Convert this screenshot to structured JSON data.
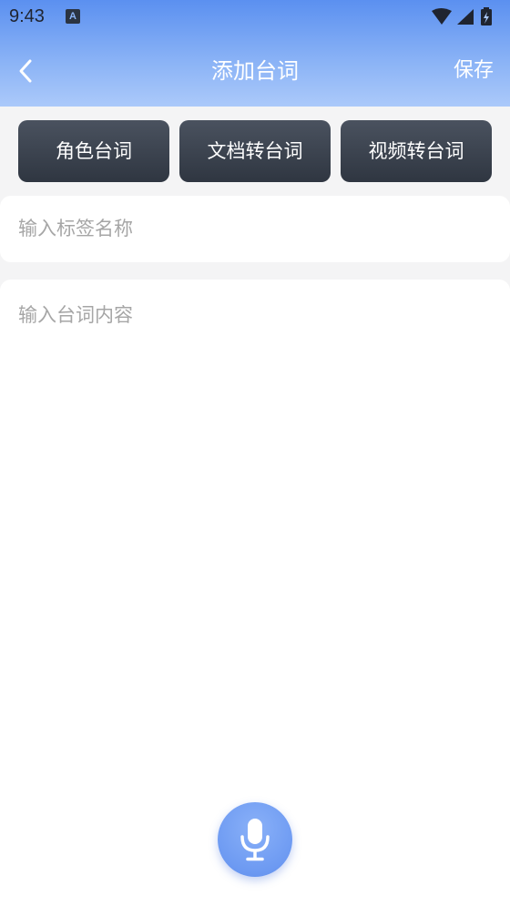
{
  "status_bar": {
    "time": "9:43",
    "notification_badge": "A",
    "icons": [
      "wifi-icon",
      "signal-icon",
      "battery-charging-icon"
    ]
  },
  "nav": {
    "back_icon": "chevron-left-icon",
    "title": "添加台词",
    "save_label": "保存"
  },
  "mode_buttons": [
    {
      "label": "角色台词"
    },
    {
      "label": "文档转台词"
    },
    {
      "label": "视频转台词"
    }
  ],
  "tag_input": {
    "placeholder": "输入标签名称",
    "value": ""
  },
  "content_input": {
    "placeholder": "输入台词内容",
    "value": ""
  },
  "mic": {
    "icon": "microphone-icon"
  },
  "colors": {
    "header_top": "#5b90f0",
    "header_bottom": "#abc9fa",
    "mode_button_bg": "#353c47",
    "mic_bg": "#6d9af2",
    "placeholder": "#a6a6a6",
    "page_bg": "#f4f4f5"
  }
}
